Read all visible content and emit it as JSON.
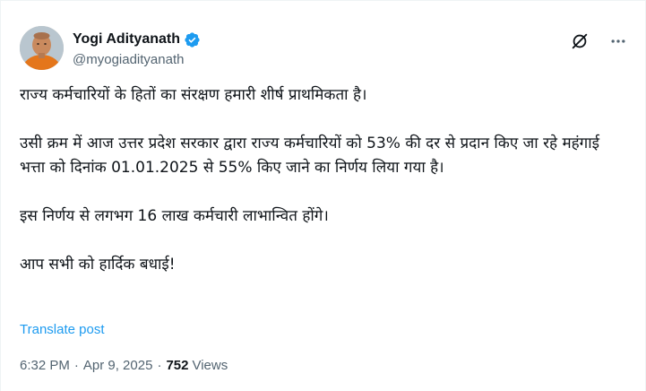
{
  "author": {
    "display_name": "Yogi Adityanath",
    "handle": "@myogiadityanath",
    "verified": true,
    "avatar_icon": "profile-photo"
  },
  "post": {
    "paragraphs": [
      "राज्य कर्मचारियों के हितों का संरक्षण हमारी शीर्ष प्राथमिकता है।",
      "उसी क्रम में आज उत्तर प्रदेश सरकार द्वारा राज्य कर्मचारियों को 53% की दर से प्रदान किए जा रहे महंगाई भत्ता को दिनांक 01.01.2025 से 55% किए जाने का निर्णय लिया गया है।",
      "इस निर्णय से लगभग 16 लाख कर्मचारी लाभान्वित होंगे।",
      "आप सभी को हार्दिक बधाई!"
    ],
    "translate_label": "Translate post"
  },
  "meta": {
    "time": "6:32 PM",
    "separator": "·",
    "date": "Apr 9, 2025",
    "views_count": "752",
    "views_label": "Views"
  },
  "icons": {
    "verified_badge": "verified-badge-icon",
    "grok": "grok-icon",
    "more": "more-options-icon"
  },
  "colors": {
    "link": "#1d9bf0",
    "secondary_text": "#536471",
    "primary_text": "#0f1419",
    "verified": "#1d9bf0"
  }
}
